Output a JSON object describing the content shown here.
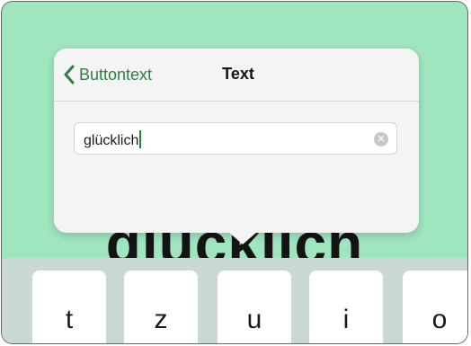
{
  "background_word": "glücklich",
  "popover": {
    "back_label": "Buttontext",
    "title": "Text",
    "field_value": "glücklich",
    "clear_icon": "clear-circle-icon"
  },
  "keyboard": {
    "keys": [
      "t",
      "z",
      "u",
      "i",
      "o"
    ]
  },
  "colors": {
    "background": "#9fe6bf",
    "accent": "#2f7d45",
    "keyboard": "#c9d8d2"
  }
}
